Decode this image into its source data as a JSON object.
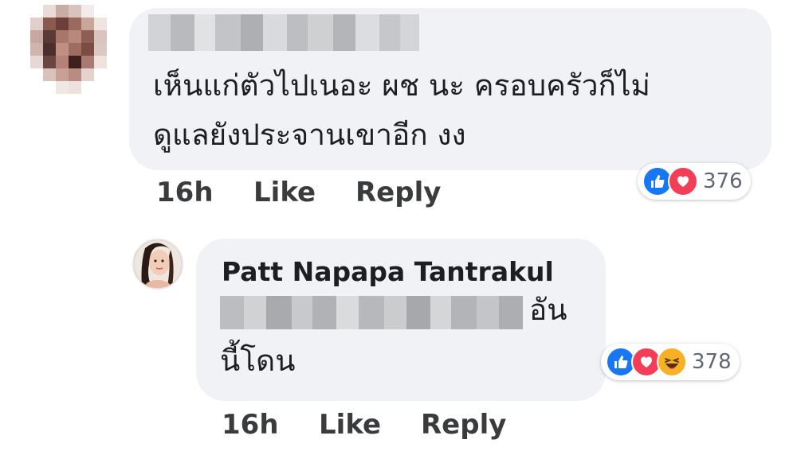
{
  "comments": [
    {
      "text_lines": [
        "เห็นแก่ตัวไปเนอะ ผช นะ ครอบครัวก็ไม่",
        "ดูแลยังประจานเขาอีก งง"
      ],
      "time": "16h",
      "like_label": "Like",
      "reply_label": "Reply",
      "reaction_count": "376",
      "reactions": [
        "like-icon",
        "love-icon"
      ]
    },
    {
      "author": "Patt Napapa Tantrakul",
      "text_line1_suffix": "อัน",
      "text_line2": "นี้โดน",
      "time": "16h",
      "like_label": "Like",
      "reply_label": "Reply",
      "reaction_count": "378",
      "reactions": [
        "like-icon",
        "love-icon",
        "haha-icon"
      ]
    }
  ],
  "colors": {
    "bubble": "#f0f2f5",
    "like": "#1877f2",
    "love": "#f33e58",
    "haha": "#f7b125",
    "meta_text": "#3a3b3c"
  }
}
